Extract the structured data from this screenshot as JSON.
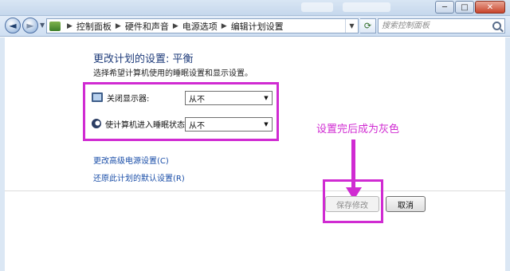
{
  "window": {
    "caption": {
      "minimize": "─",
      "maximize": "□",
      "close": "✕"
    }
  },
  "nav": {
    "back_icon": "◄",
    "forward_icon": "►",
    "breadcrumb": [
      "控制面板",
      "硬件和声音",
      "电源选项",
      "编辑计划设置"
    ],
    "search_placeholder": "搜索控制面板"
  },
  "main": {
    "title": "更改计划的设置: 平衡",
    "subtitle": "选择希望计算机使用的睡眠设置和显示设置。",
    "settings": [
      {
        "label": "关闭显示器:",
        "value": "从不",
        "icon": "monitor-icon"
      },
      {
        "label": "使计算机进入睡眠状态:",
        "value": "从不",
        "icon": "moon-icon"
      }
    ],
    "links": {
      "advanced": "更改高级电源设置(C)",
      "restore": "还原此计划的默认设置(R)"
    },
    "buttons": {
      "save": "保存修改",
      "cancel": "取消"
    }
  },
  "annotation": {
    "text": "设置完后成为灰色",
    "color": "#d02bd2"
  }
}
